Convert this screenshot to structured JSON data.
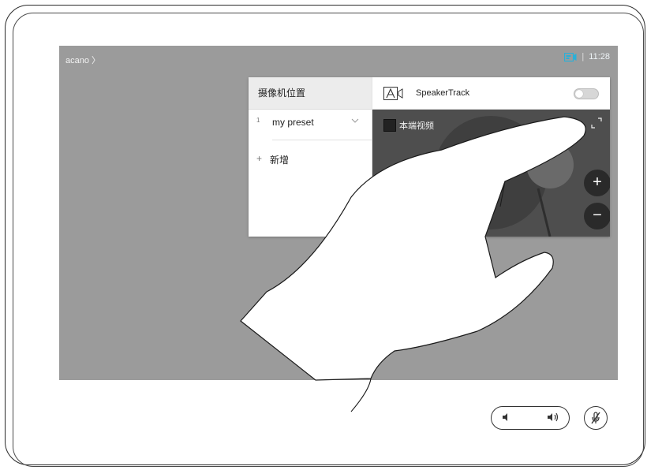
{
  "header": {
    "breadcrumb": "acano",
    "breadcrumb_chevron": "〉",
    "separator": "|",
    "clock": "11:28"
  },
  "presets_panel": {
    "title": "摄像机位置",
    "presets": [
      {
        "number": "1",
        "name": "my preset"
      }
    ],
    "add_label": "新增",
    "add_symbol": "+"
  },
  "camera_panel": {
    "speakertrack_label": "SpeakerTrack",
    "speakertrack_enabled": false,
    "selfview_label": "本端视频",
    "zoom_in_symbol": "+",
    "zoom_out_symbol": "−"
  },
  "colors": {
    "screen_bg": "#9b9b9b",
    "accent": "#2ab0d8",
    "video_bg": "#4e4e4e"
  },
  "icons": [
    "camera-status-icon",
    "speakertrack-icon",
    "selfview-checkbox-icon",
    "fullscreen-icon",
    "volume-down-icon",
    "volume-up-icon",
    "mic-mute-icon",
    "hand-gesture-illustration"
  ]
}
